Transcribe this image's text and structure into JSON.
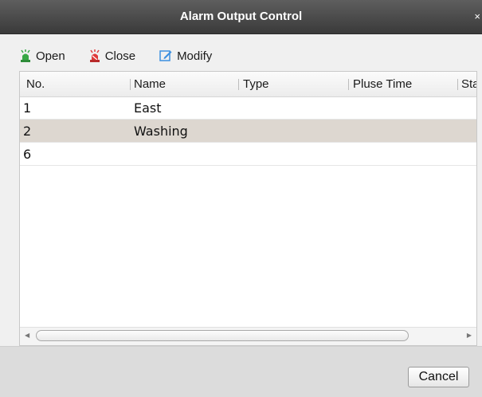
{
  "dialog": {
    "title": "Alarm Output Control",
    "close_glyph": "×"
  },
  "toolbar": {
    "open_label": "Open",
    "close_label": "Close",
    "modify_label": "Modify",
    "open_icon": "alarm-on-icon",
    "close_icon": "alarm-off-icon",
    "modify_icon": "edit-icon"
  },
  "table": {
    "columns": [
      "No.",
      "Name",
      "Type",
      "Pluse Time",
      "Sta"
    ],
    "rows": [
      {
        "no": "1",
        "name": "East"
      },
      {
        "no": "2",
        "name": "Washing"
      },
      {
        "no": "6",
        "name": ""
      }
    ],
    "selected_row_index": 1
  },
  "footer": {
    "cancel_label": "Cancel"
  },
  "colors": {
    "titlebar": "#3a3a3a",
    "selected_row": "#ddd7d0",
    "open_icon": "#37a845",
    "close_icon": "#e03a3a",
    "modify_icon": "#3c8fe0"
  }
}
